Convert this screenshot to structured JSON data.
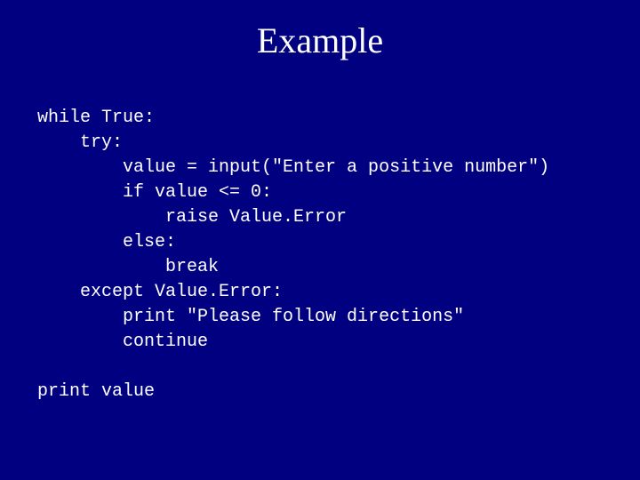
{
  "title": "Example",
  "code": "while True:\n    try:\n        value = input(\"Enter a positive number\")\n        if value <= 0:\n            raise Value.Error\n        else:\n            break\n    except Value.Error:\n        print \"Please follow directions\"\n        continue\n\nprint value"
}
